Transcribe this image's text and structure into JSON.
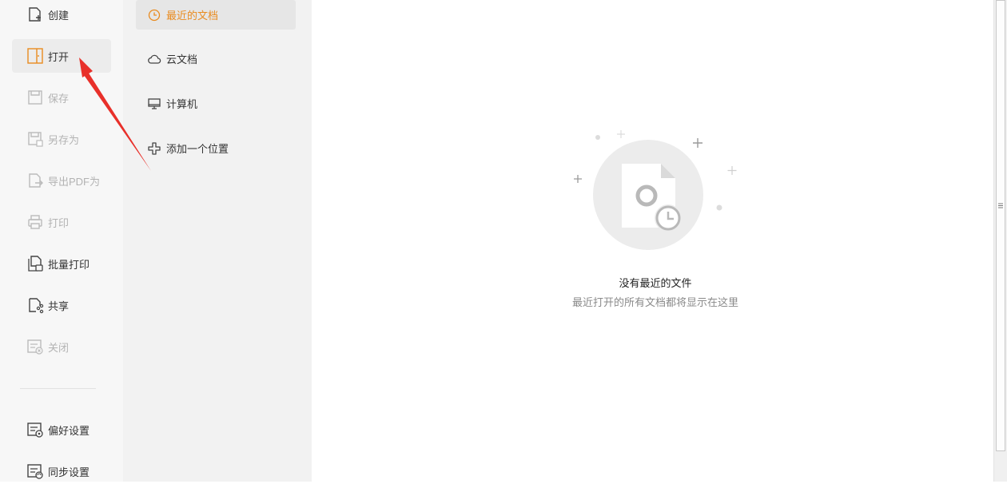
{
  "nav": {
    "create": "创建",
    "open": "打开",
    "save": "保存",
    "save_as": "另存为",
    "export_pdf": "导出PDF为",
    "print": "打印",
    "batch_print": "批量打印",
    "share": "共享",
    "close": "关闭",
    "preferences": "偏好设置",
    "sync_settings": "同步设置"
  },
  "locations": {
    "recent": "最近的文档",
    "cloud": "云文档",
    "computer": "计算机",
    "add_place": "添加一个位置"
  },
  "empty_state": {
    "title": "没有最近的文件",
    "subtitle": "最近打开的所有文档都将显示在这里"
  },
  "colors": {
    "accent": "#e98b1f",
    "annotation_arrow": "#e8302a"
  },
  "icons": [
    "file-plus-icon",
    "open-book-icon",
    "save-icon",
    "save-as-icon",
    "export-pdf-icon",
    "printer-icon",
    "batch-print-icon",
    "share-icon",
    "close-doc-icon",
    "preferences-icon",
    "sync-settings-icon",
    "clock-icon",
    "cloud-icon",
    "monitor-icon",
    "add-place-icon",
    "recent-file-illustration",
    "red-arrow-annotation"
  ]
}
